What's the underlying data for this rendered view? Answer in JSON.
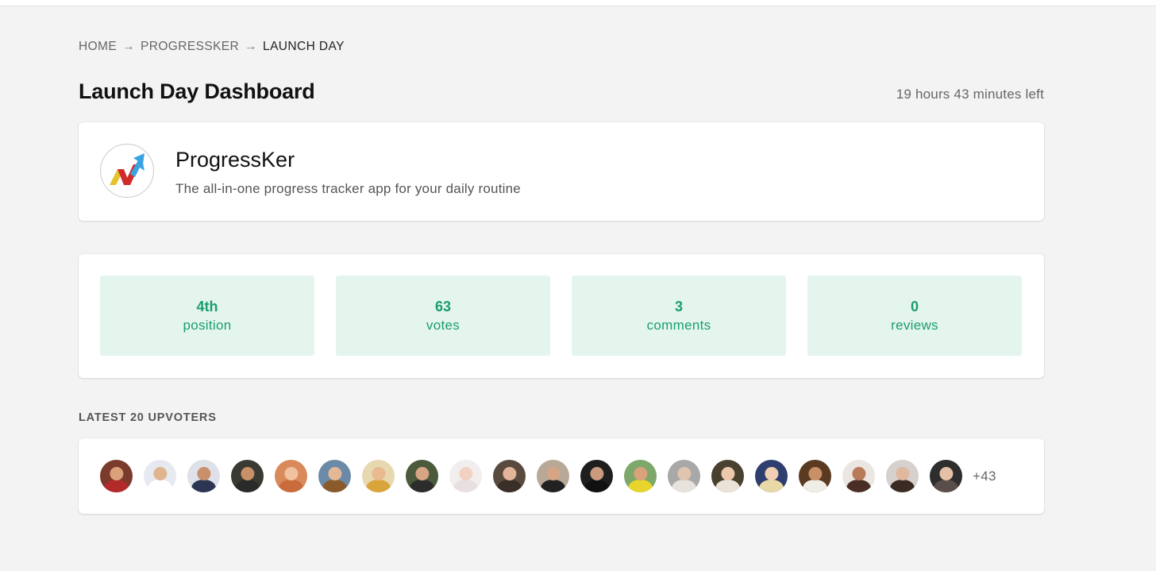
{
  "breadcrumb": {
    "items": [
      "HOME",
      "PROGRESSKER"
    ],
    "current": "LAUNCH DAY",
    "separator": "→"
  },
  "header": {
    "title": "Launch Day Dashboard",
    "time_left": "19 hours 43 minutes left"
  },
  "product": {
    "logo_icon": "progressker-logo-icon",
    "name": "ProgressKer",
    "tagline": "The all-in-one progress tracker app for your daily routine"
  },
  "stats": [
    {
      "value": "4th",
      "label": "position"
    },
    {
      "value": "63",
      "label": "votes"
    },
    {
      "value": "3",
      "label": "comments"
    },
    {
      "value": "0",
      "label": "reviews"
    }
  ],
  "upvoters": {
    "heading": "LATEST 20 UPVOTERS",
    "more_count": "+43",
    "avatars": [
      {
        "bg": "#7a3b2c",
        "skin": "#d9a27a",
        "shirt": "#b22a2a"
      },
      {
        "bg": "#e6eaf0",
        "skin": "#e0b48e",
        "shirt": "#ffffff"
      },
      {
        "bg": "#dfe1e8",
        "skin": "#c9906c",
        "shirt": "#2c3552"
      },
      {
        "bg": "#3a3a33",
        "skin": "#c98f66",
        "shirt": "#2a2a2a"
      },
      {
        "bg": "#d98a5a",
        "skin": "#f0c2a0",
        "shirt": "#c96b3b"
      },
      {
        "bg": "#6b8aa8",
        "skin": "#e4b896",
        "shirt": "#8a5a2a"
      },
      {
        "bg": "#e8d8b0",
        "skin": "#e9b98f",
        "shirt": "#d9a53a"
      },
      {
        "bg": "#4a5a3a",
        "skin": "#d6a585",
        "shirt": "#2c2c2c"
      },
      {
        "bg": "#f2eeee",
        "skin": "#f1d2c2",
        "shirt": "#e8e0e0"
      },
      {
        "bg": "#5a4a3e",
        "skin": "#e2b59a",
        "shirt": "#3a2e28"
      },
      {
        "bg": "#b8a898",
        "skin": "#d5a586",
        "shirt": "#222222"
      },
      {
        "bg": "#1e1e1e",
        "skin": "#c99a7e",
        "shirt": "#111111"
      },
      {
        "bg": "#7da86a",
        "skin": "#d9a27c",
        "shirt": "#e8d42a"
      },
      {
        "bg": "#a8a8a8",
        "skin": "#e0c4b0",
        "shirt": "#e8e2dc"
      },
      {
        "bg": "#4a4030",
        "skin": "#edc9ac",
        "shirt": "#ebe3d8"
      },
      {
        "bg": "#2e3e6e",
        "skin": "#f0cfb4",
        "shirt": "#e8d9a6"
      },
      {
        "bg": "#5a3a20",
        "skin": "#c98f66",
        "shirt": "#f0ece6"
      },
      {
        "bg": "#ece6e2",
        "skin": "#b97a5a",
        "shirt": "#4a2e26"
      },
      {
        "bg": "#d6d0ce",
        "skin": "#e0b89e",
        "shirt": "#3a2a22"
      },
      {
        "bg": "#2e2e2e",
        "skin": "#e4c0a6",
        "shirt": "#5a4e4a"
      }
    ]
  },
  "colors": {
    "accent": "#1a9e6c",
    "stat_bg": "#e4f5ee",
    "page_bg": "#f3f3f3"
  }
}
